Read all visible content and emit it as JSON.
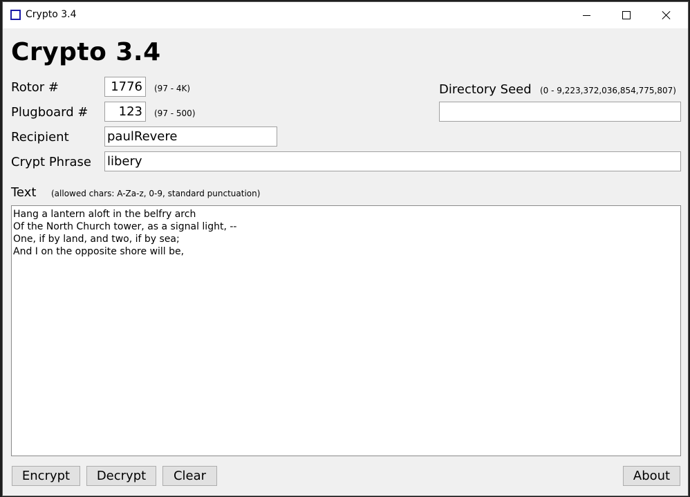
{
  "window": {
    "title": "Crypto 3.4",
    "icon": "app-square-icon"
  },
  "heading": "Crypto 3.4",
  "rotor": {
    "label": "Rotor #",
    "value": "1776",
    "range": "(97 - 4K)"
  },
  "plugboard": {
    "label": "Plugboard #",
    "value": "123",
    "range": "(97 - 500)"
  },
  "recipient": {
    "label": "Recipient",
    "value": "paulRevere"
  },
  "crypt_phrase": {
    "label": "Crypt Phrase",
    "value": "libery"
  },
  "directory_seed": {
    "label": "Directory Seed",
    "range": "(0 - 9,223,372,036,854,775,807)",
    "value": ""
  },
  "text": {
    "label": "Text",
    "hint": "(allowed chars: A-Za-z, 0-9, standard punctuation)",
    "lines": [
      "Hang a lantern aloft in the belfry arch",
      "Of the North Church tower, as a signal light, --",
      "One, if by land, and two, if by sea;",
      "And I on the opposite shore will be,"
    ]
  },
  "buttons": {
    "encrypt": "Encrypt",
    "decrypt": "Decrypt",
    "clear": "Clear",
    "about": "About"
  },
  "colors": {
    "window_bg": "#f0f0f0",
    "titlebar_bg": "#ffffff",
    "icon_border": "#1a1aa8",
    "button_bg": "#e1e1e1"
  }
}
